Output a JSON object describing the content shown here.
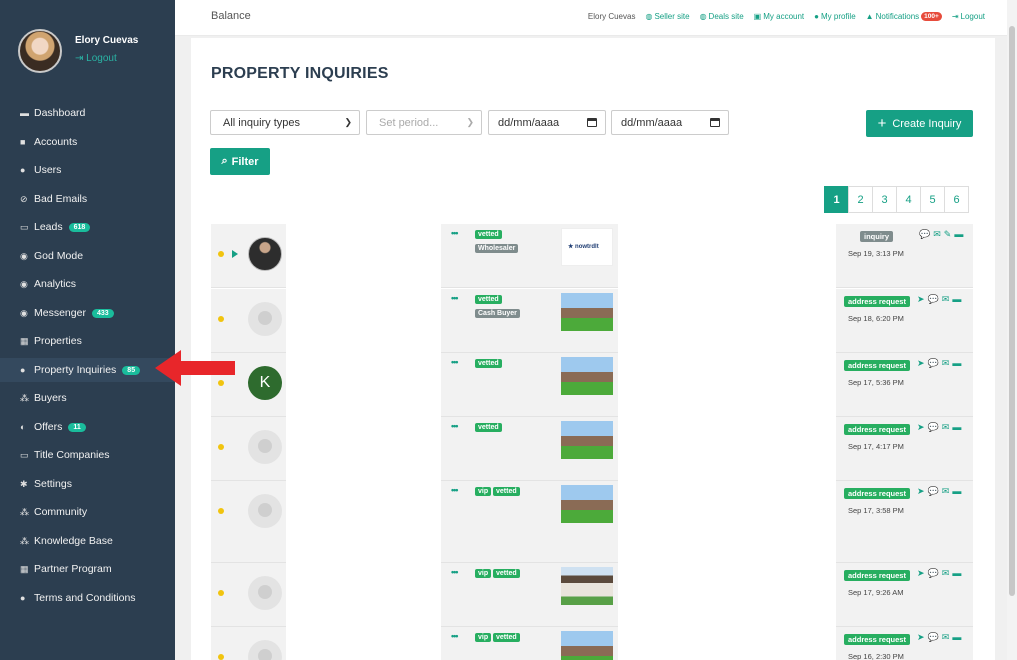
{
  "sidebar": {
    "user_name": "Elory Cuevas",
    "logout": "Logout",
    "items": [
      {
        "label": "Dashboard",
        "icon": "▬",
        "badge": null
      },
      {
        "label": "Accounts",
        "icon": "■",
        "badge": null
      },
      {
        "label": "Users",
        "icon": "●",
        "badge": null
      },
      {
        "label": "Bad Emails",
        "icon": "⊘",
        "badge": null
      },
      {
        "label": "Leads",
        "icon": "▭",
        "badge": "618"
      },
      {
        "label": "God Mode",
        "icon": "◉",
        "badge": null
      },
      {
        "label": "Analytics",
        "icon": "◉",
        "badge": null
      },
      {
        "label": "Messenger",
        "icon": "◉",
        "badge": "433"
      },
      {
        "label": "Properties",
        "icon": "▦",
        "badge": null
      },
      {
        "label": "Property Inquiries",
        "icon": "●",
        "badge": "85"
      },
      {
        "label": "Buyers",
        "icon": "⁂",
        "badge": null
      },
      {
        "label": "Offers",
        "icon": "◐",
        "badge": "11"
      },
      {
        "label": "Title Companies",
        "icon": "▭",
        "badge": null
      },
      {
        "label": "Settings",
        "icon": "✱",
        "badge": null
      },
      {
        "label": "Community",
        "icon": "⁂",
        "badge": null
      },
      {
        "label": "Knowledge Base",
        "icon": "⁂",
        "badge": null
      },
      {
        "label": "Partner Program",
        "icon": "▦",
        "badge": null
      },
      {
        "label": "Terms and Conditions",
        "icon": "●",
        "badge": null
      }
    ]
  },
  "topbar": {
    "brand": "Balance",
    "user": "Elory Cuevas",
    "seller_site": "Seller site",
    "deals_site": "Deals site",
    "my_account": "My account",
    "my_profile": "My profile",
    "notifications": "Notifications",
    "notifications_badge": "100+",
    "logout": "Logout"
  },
  "page": {
    "title": "PROPERTY INQUIRIES",
    "inquiry_type": "All inquiry types",
    "period_placeholder": "Set period...",
    "date_from": "dd/mm/aaaa",
    "date_to": "dd/mm/aaaa",
    "create_label": "Create Inquiry",
    "filter_label": "Filter",
    "pages": [
      "1",
      "2",
      "3",
      "4",
      "5",
      "6"
    ],
    "active_page": "1"
  },
  "rows": [
    {
      "avatar": "photo",
      "tags": [
        "vetted",
        "Wholesaler"
      ],
      "thumb": "logo",
      "thumb_text": "★ nowtrdlt",
      "status": "inquiry",
      "status_style": "gray",
      "date": "Sep 19, 3:13 PM",
      "actions": [
        "💬",
        "✉",
        "✎",
        "▬"
      ]
    },
    {
      "avatar": "placeholder",
      "tags": [
        "vetted",
        "Cash Buyer"
      ],
      "thumb": "house",
      "thumb_text": "",
      "status": "address request",
      "status_style": "green",
      "date": "Sep 18, 6:20 PM",
      "actions": [
        "➤",
        "💬",
        "✉",
        "▬"
      ]
    },
    {
      "avatar": "letter",
      "letter": "K",
      "tags": [
        "vetted"
      ],
      "thumb": "house",
      "thumb_text": "",
      "status": "address request",
      "status_style": "green",
      "date": "Sep 17, 5:36 PM",
      "actions": [
        "➤",
        "💬",
        "✉",
        "▬"
      ]
    },
    {
      "avatar": "placeholder",
      "tags": [
        "vetted"
      ],
      "thumb": "house",
      "thumb_text": "",
      "status": "address request",
      "status_style": "green",
      "date": "Sep 17, 4:17 PM",
      "actions": [
        "➤",
        "💬",
        "✉",
        "▬"
      ]
    },
    {
      "avatar": "placeholder",
      "tags": [
        "vip",
        "vetted"
      ],
      "thumb": "house",
      "thumb_text": "",
      "status": "address request",
      "status_style": "green",
      "date": "Sep 17, 3:58 PM",
      "actions": [
        "➤",
        "💬",
        "✉",
        "▬"
      ]
    },
    {
      "avatar": "placeholder",
      "tags": [
        "vip",
        "vetted"
      ],
      "thumb": "house2",
      "thumb_text": "",
      "status": "address request",
      "status_style": "green",
      "date": "Sep 17, 9:26 AM",
      "actions": [
        "➤",
        "💬",
        "✉",
        "▬"
      ]
    },
    {
      "avatar": "placeholder",
      "tags": [
        "vip",
        "vetted"
      ],
      "thumb": "house",
      "thumb_text": "",
      "status": "address request",
      "status_style": "green",
      "date": "Sep 16, 2:30 PM",
      "actions": [
        "➤",
        "💬",
        "✉",
        "▬"
      ]
    }
  ]
}
